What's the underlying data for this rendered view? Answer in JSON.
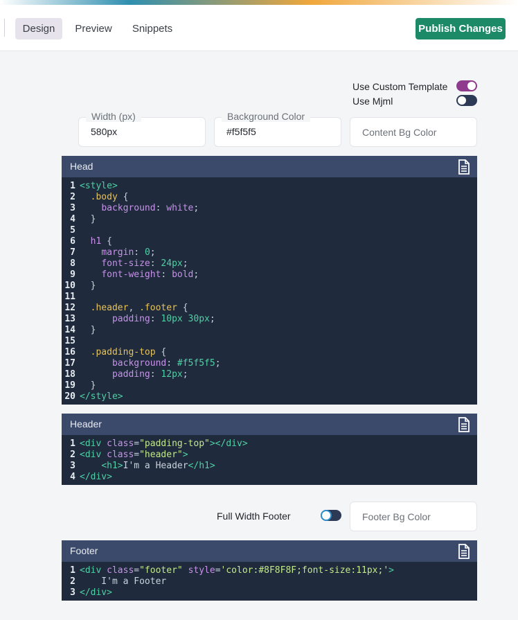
{
  "tabs": [
    {
      "label": "Design",
      "active": true
    },
    {
      "label": "Preview",
      "active": false
    },
    {
      "label": "Snippets",
      "active": false
    }
  ],
  "publish_label": "Publish Changes",
  "settings": {
    "use_custom_template": {
      "label": "Use Custom Template",
      "on": true
    },
    "use_mjml": {
      "label": "Use Mjml",
      "on": false
    },
    "width": {
      "label": "Width (px)",
      "value": "580px"
    },
    "background_color": {
      "label": "Background Color",
      "value": "#f5f5f5"
    },
    "content_bg_color": {
      "placeholder": "Content Bg Color"
    },
    "full_width_footer": {
      "label": "Full Width Footer",
      "on": false
    },
    "footer_bg_color": {
      "placeholder": "Footer Bg Color"
    }
  },
  "colors": {
    "accent_purple": "#8e3b8e",
    "toggle_off": "#2c3a55",
    "publish_green": "#1c8a67",
    "panel_header": "#3b4a6b",
    "code_bg": "#1f2a3c"
  },
  "panels": {
    "head": {
      "title": "Head",
      "lines": [
        [
          [
            "t-tag",
            "<style>"
          ]
        ],
        [
          [
            "t-plain",
            "  "
          ],
          [
            "t-sel",
            ".body"
          ],
          [
            "t-plain",
            " {"
          ]
        ],
        [
          [
            "t-plain",
            "    "
          ],
          [
            "t-prop",
            "background"
          ],
          [
            "t-plain",
            ": "
          ],
          [
            "t-prop",
            "white"
          ],
          [
            "t-plain",
            ";"
          ]
        ],
        [
          [
            "t-plain",
            "  }"
          ]
        ],
        [
          [
            "t-plain",
            ""
          ]
        ],
        [
          [
            "t-plain",
            "  "
          ],
          [
            "t-prop",
            "h1"
          ],
          [
            "t-plain",
            " {"
          ]
        ],
        [
          [
            "t-plain",
            "    "
          ],
          [
            "t-prop",
            "margin"
          ],
          [
            "t-plain",
            ": "
          ],
          [
            "t-val",
            "0"
          ],
          [
            "t-plain",
            ";"
          ]
        ],
        [
          [
            "t-plain",
            "    "
          ],
          [
            "t-prop",
            "font-size"
          ],
          [
            "t-plain",
            ": "
          ],
          [
            "t-val",
            "24px"
          ],
          [
            "t-plain",
            ";"
          ]
        ],
        [
          [
            "t-plain",
            "    "
          ],
          [
            "t-prop",
            "font-weight"
          ],
          [
            "t-plain",
            ": "
          ],
          [
            "t-prop",
            "bold"
          ],
          [
            "t-plain",
            ";"
          ]
        ],
        [
          [
            "t-plain",
            "  }"
          ]
        ],
        [
          [
            "t-plain",
            ""
          ]
        ],
        [
          [
            "t-plain",
            "  "
          ],
          [
            "t-sel",
            ".header"
          ],
          [
            "t-plain",
            ", "
          ],
          [
            "t-sel",
            ".footer"
          ],
          [
            "t-plain",
            " {"
          ]
        ],
        [
          [
            "t-plain",
            "      "
          ],
          [
            "t-prop",
            "padding"
          ],
          [
            "t-plain",
            ": "
          ],
          [
            "t-val",
            "10px 30px"
          ],
          [
            "t-plain",
            ";"
          ]
        ],
        [
          [
            "t-plain",
            "  }"
          ]
        ],
        [
          [
            "t-plain",
            ""
          ]
        ],
        [
          [
            "t-plain",
            "  "
          ],
          [
            "t-sel",
            ".padding-top"
          ],
          [
            "t-plain",
            " {"
          ]
        ],
        [
          [
            "t-plain",
            "      "
          ],
          [
            "t-prop",
            "background"
          ],
          [
            "t-plain",
            ": "
          ],
          [
            "t-val",
            "#f5f5f5"
          ],
          [
            "t-plain",
            ";"
          ]
        ],
        [
          [
            "t-plain",
            "      "
          ],
          [
            "t-prop",
            "padding"
          ],
          [
            "t-plain",
            ": "
          ],
          [
            "t-val",
            "12px"
          ],
          [
            "t-plain",
            ";"
          ]
        ],
        [
          [
            "t-plain",
            "  }"
          ]
        ],
        [
          [
            "t-tag",
            "</style>"
          ]
        ]
      ]
    },
    "header": {
      "title": "Header",
      "lines": [
        [
          [
            "t-tag",
            "<div "
          ],
          [
            "t-attr",
            "class"
          ],
          [
            "t-plain",
            "="
          ],
          [
            "t-str",
            "\"padding-top\""
          ],
          [
            "t-tag",
            "></div>"
          ]
        ],
        [
          [
            "t-tag",
            "<div "
          ],
          [
            "t-attr",
            "class"
          ],
          [
            "t-plain",
            "="
          ],
          [
            "t-str",
            "\"header\""
          ],
          [
            "t-tag",
            ">"
          ]
        ],
        [
          [
            "t-plain",
            "    "
          ],
          [
            "t-tag",
            "<h1>"
          ],
          [
            "t-plain",
            "I'm a Header"
          ],
          [
            "t-tag",
            "</h1>"
          ]
        ],
        [
          [
            "t-tag",
            "</div>"
          ]
        ]
      ]
    },
    "footer": {
      "title": "Footer",
      "lines": [
        [
          [
            "t-tag",
            "<div "
          ],
          [
            "t-attr",
            "class"
          ],
          [
            "t-plain",
            "="
          ],
          [
            "t-str",
            "\"footer\""
          ],
          [
            "t-plain",
            " "
          ],
          [
            "t-attr",
            "style"
          ],
          [
            "t-plain",
            "="
          ],
          [
            "t-str",
            "'color:#8F8F8F;font-size:11px;'"
          ],
          [
            "t-tag",
            ">"
          ]
        ],
        [
          [
            "t-plain",
            "    I'm a Footer"
          ]
        ],
        [
          [
            "t-tag",
            "</div>"
          ]
        ]
      ]
    }
  }
}
